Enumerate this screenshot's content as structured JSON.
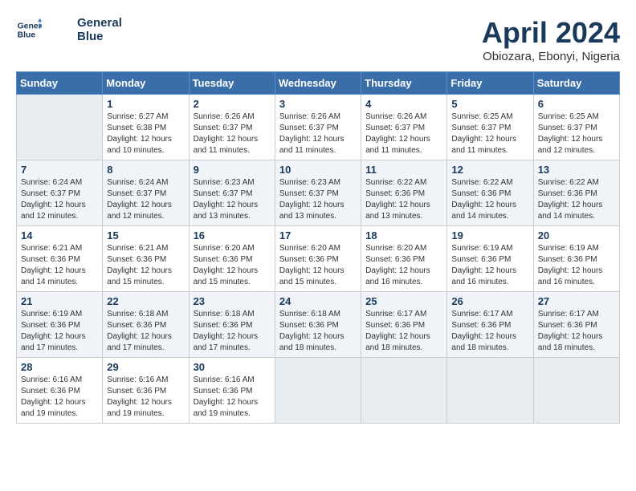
{
  "header": {
    "logo_line1": "General",
    "logo_line2": "Blue",
    "month_title": "April 2024",
    "subtitle": "Obiozara, Ebonyi, Nigeria"
  },
  "weekdays": [
    "Sunday",
    "Monday",
    "Tuesday",
    "Wednesday",
    "Thursday",
    "Friday",
    "Saturday"
  ],
  "weeks": [
    [
      {
        "day": "",
        "info": ""
      },
      {
        "day": "1",
        "info": "Sunrise: 6:27 AM\nSunset: 6:38 PM\nDaylight: 12 hours\nand 10 minutes."
      },
      {
        "day": "2",
        "info": "Sunrise: 6:26 AM\nSunset: 6:37 PM\nDaylight: 12 hours\nand 11 minutes."
      },
      {
        "day": "3",
        "info": "Sunrise: 6:26 AM\nSunset: 6:37 PM\nDaylight: 12 hours\nand 11 minutes."
      },
      {
        "day": "4",
        "info": "Sunrise: 6:26 AM\nSunset: 6:37 PM\nDaylight: 12 hours\nand 11 minutes."
      },
      {
        "day": "5",
        "info": "Sunrise: 6:25 AM\nSunset: 6:37 PM\nDaylight: 12 hours\nand 11 minutes."
      },
      {
        "day": "6",
        "info": "Sunrise: 6:25 AM\nSunset: 6:37 PM\nDaylight: 12 hours\nand 12 minutes."
      }
    ],
    [
      {
        "day": "7",
        "info": "Sunrise: 6:24 AM\nSunset: 6:37 PM\nDaylight: 12 hours\nand 12 minutes."
      },
      {
        "day": "8",
        "info": "Sunrise: 6:24 AM\nSunset: 6:37 PM\nDaylight: 12 hours\nand 12 minutes."
      },
      {
        "day": "9",
        "info": "Sunrise: 6:23 AM\nSunset: 6:37 PM\nDaylight: 12 hours\nand 13 minutes."
      },
      {
        "day": "10",
        "info": "Sunrise: 6:23 AM\nSunset: 6:37 PM\nDaylight: 12 hours\nand 13 minutes."
      },
      {
        "day": "11",
        "info": "Sunrise: 6:22 AM\nSunset: 6:36 PM\nDaylight: 12 hours\nand 13 minutes."
      },
      {
        "day": "12",
        "info": "Sunrise: 6:22 AM\nSunset: 6:36 PM\nDaylight: 12 hours\nand 14 minutes."
      },
      {
        "day": "13",
        "info": "Sunrise: 6:22 AM\nSunset: 6:36 PM\nDaylight: 12 hours\nand 14 minutes."
      }
    ],
    [
      {
        "day": "14",
        "info": "Sunrise: 6:21 AM\nSunset: 6:36 PM\nDaylight: 12 hours\nand 14 minutes."
      },
      {
        "day": "15",
        "info": "Sunrise: 6:21 AM\nSunset: 6:36 PM\nDaylight: 12 hours\nand 15 minutes."
      },
      {
        "day": "16",
        "info": "Sunrise: 6:20 AM\nSunset: 6:36 PM\nDaylight: 12 hours\nand 15 minutes."
      },
      {
        "day": "17",
        "info": "Sunrise: 6:20 AM\nSunset: 6:36 PM\nDaylight: 12 hours\nand 15 minutes."
      },
      {
        "day": "18",
        "info": "Sunrise: 6:20 AM\nSunset: 6:36 PM\nDaylight: 12 hours\nand 16 minutes."
      },
      {
        "day": "19",
        "info": "Sunrise: 6:19 AM\nSunset: 6:36 PM\nDaylight: 12 hours\nand 16 minutes."
      },
      {
        "day": "20",
        "info": "Sunrise: 6:19 AM\nSunset: 6:36 PM\nDaylight: 12 hours\nand 16 minutes."
      }
    ],
    [
      {
        "day": "21",
        "info": "Sunrise: 6:19 AM\nSunset: 6:36 PM\nDaylight: 12 hours\nand 17 minutes."
      },
      {
        "day": "22",
        "info": "Sunrise: 6:18 AM\nSunset: 6:36 PM\nDaylight: 12 hours\nand 17 minutes."
      },
      {
        "day": "23",
        "info": "Sunrise: 6:18 AM\nSunset: 6:36 PM\nDaylight: 12 hours\nand 17 minutes."
      },
      {
        "day": "24",
        "info": "Sunrise: 6:18 AM\nSunset: 6:36 PM\nDaylight: 12 hours\nand 18 minutes."
      },
      {
        "day": "25",
        "info": "Sunrise: 6:17 AM\nSunset: 6:36 PM\nDaylight: 12 hours\nand 18 minutes."
      },
      {
        "day": "26",
        "info": "Sunrise: 6:17 AM\nSunset: 6:36 PM\nDaylight: 12 hours\nand 18 minutes."
      },
      {
        "day": "27",
        "info": "Sunrise: 6:17 AM\nSunset: 6:36 PM\nDaylight: 12 hours\nand 18 minutes."
      }
    ],
    [
      {
        "day": "28",
        "info": "Sunrise: 6:16 AM\nSunset: 6:36 PM\nDaylight: 12 hours\nand 19 minutes."
      },
      {
        "day": "29",
        "info": "Sunrise: 6:16 AM\nSunset: 6:36 PM\nDaylight: 12 hours\nand 19 minutes."
      },
      {
        "day": "30",
        "info": "Sunrise: 6:16 AM\nSunset: 6:36 PM\nDaylight: 12 hours\nand 19 minutes."
      },
      {
        "day": "",
        "info": ""
      },
      {
        "day": "",
        "info": ""
      },
      {
        "day": "",
        "info": ""
      },
      {
        "day": "",
        "info": ""
      }
    ]
  ]
}
